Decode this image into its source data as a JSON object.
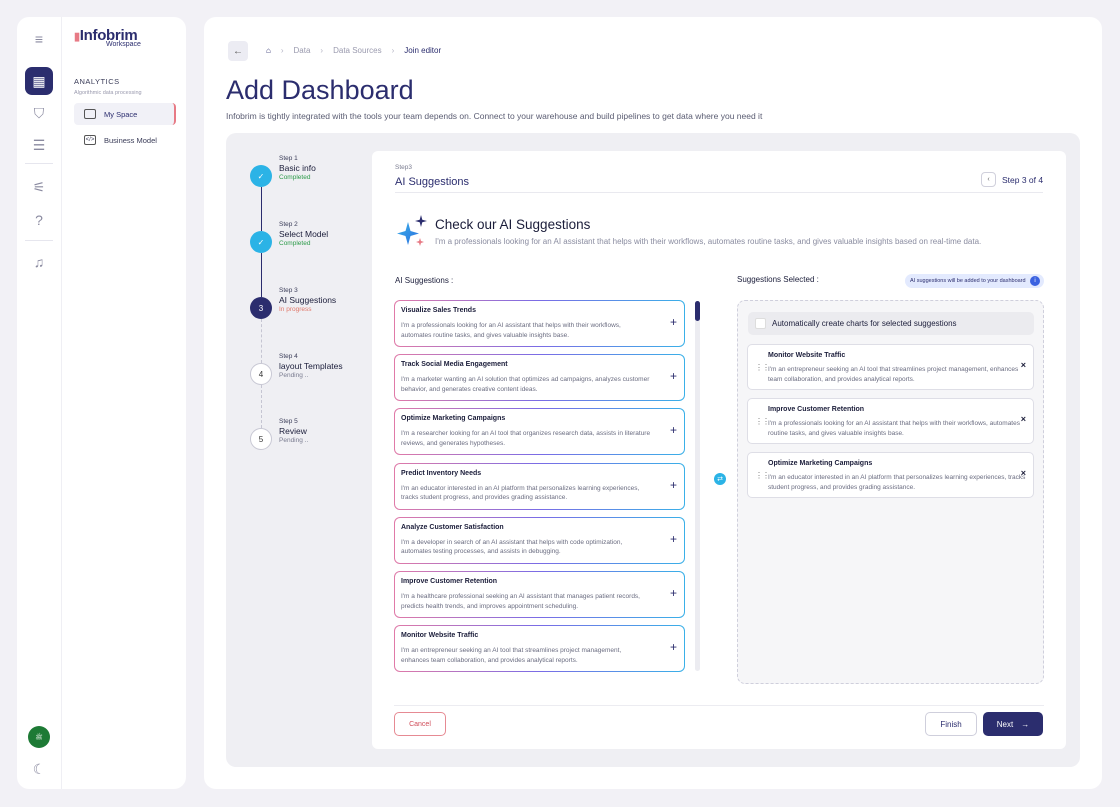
{
  "app": {
    "logo_text": "Infobrim",
    "logo_sub": "Workspace",
    "avatar_text": "ﷺ"
  },
  "rail": {
    "icons": [
      "menu-icon",
      "analytics-icon",
      "shield-icon",
      "database-icon",
      "sliders-icon",
      "help-icon",
      "bell-icon",
      "theme-toggle-icon"
    ],
    "active": "analytics-icon",
    "symbols": {
      "menu": "≡",
      "analytics": "▦",
      "shield": "⛉",
      "database": "☰",
      "sliders": "⚟",
      "help": "?",
      "bell": "♫",
      "moon": "☾"
    }
  },
  "sidebar": {
    "section_title": "ANALYTICS",
    "section_sub": "Algorithmic data processing",
    "items": [
      {
        "label": "My Space",
        "icon": "grid-icon",
        "active": true
      },
      {
        "label": "Business Model",
        "icon": "code-icon",
        "active": false
      }
    ]
  },
  "breadcrumb": {
    "items": [
      "Data",
      "Data Sources",
      "Join editor"
    ]
  },
  "header": {
    "title": "Add Dashboard",
    "description": "Infobrim is tightly integrated with the tools your team depends on. Connect to your warehouse and build pipelines to get data where you need it"
  },
  "stepper": [
    {
      "num": "Step 1",
      "name": "Basic info",
      "status": "Completed",
      "state": "done",
      "marker": "✓"
    },
    {
      "num": "Step 2",
      "name": "Select Model",
      "status": "Completed",
      "state": "done",
      "marker": "✓"
    },
    {
      "num": "Step 3",
      "name": "AI Suggestions",
      "status": "In progress",
      "state": "current",
      "marker": "3"
    },
    {
      "num": "Step 4",
      "name": "layout Templates",
      "status": "Pending ..",
      "state": "pending",
      "marker": "4"
    },
    {
      "num": "Step 5",
      "name": "Review",
      "status": "Pending ..",
      "state": "pending",
      "marker": "5"
    }
  ],
  "status_colors": {
    "done": "#2d9b4a",
    "current": "#e0786a",
    "pending": "#7a7c90"
  },
  "card": {
    "step_label": "Step3",
    "title": "AI Suggestions",
    "step_indicator": "Step 3 of 4",
    "ai_heading": "Check our AI Suggestions",
    "ai_desc": "I'm a professionals looking for an AI assistant that helps with their workflows, automates routine tasks, and gives valuable insights based on real-time data.",
    "left_header": "AI Suggestions :",
    "right_header": "Suggestions Selected :",
    "note": "AI suggestions will be added to your dashboard",
    "auto_create_label": "Automatically create charts for selected suggestions"
  },
  "suggestions": [
    {
      "title": "Visualize Sales Trends",
      "desc": "I'm a professionals looking for an AI assistant that helps with their workflows, automates routine tasks, and gives valuable insights base."
    },
    {
      "title": "Track Social Media Engagement",
      "desc": "I'm a marketer wanting an AI solution that optimizes ad campaigns, analyzes customer behavior, and generates creative content ideas."
    },
    {
      "title": "Optimize Marketing Campaigns",
      "desc": "I'm a researcher looking for an AI tool that organizes research data, assists in literature reviews, and generates hypotheses."
    },
    {
      "title": "Predict Inventory Needs",
      "desc": "I'm an educator interested in an AI platform that personalizes learning experiences, tracks student progress, and provides grading assistance."
    },
    {
      "title": "Analyze Customer Satisfaction",
      "desc": "I'm a developer in search of an AI assistant that helps with code optimization, automates testing processes, and assists in debugging."
    },
    {
      "title": "Improve Customer Retention",
      "desc": "I'm a healthcare professional seeking an AI assistant that manages patient records, predicts health trends, and improves appointment scheduling."
    },
    {
      "title": "Monitor Website Traffic",
      "desc": "I'm an entrepreneur seeking an AI tool that streamlines project management, enhances team collaboration, and provides analytical reports."
    }
  ],
  "selected": [
    {
      "title": "Monitor Website Traffic",
      "desc": "I'm an entrepreneur seeking an AI tool that streamlines project management, enhances team collaboration, and provides analytical reports."
    },
    {
      "title": "Improve Customer Retention",
      "desc": "I'm a professionals looking for an AI assistant that helps with their workflows, automates routine tasks, and gives valuable insights base."
    },
    {
      "title": "Optimize Marketing Campaigns",
      "desc": "I'm an educator interested in an AI platform that personalizes learning experiences, tracks student progress, and provides grading assistance."
    }
  ],
  "footer": {
    "cancel": "Cancel",
    "finish": "Finish",
    "next": "Next"
  }
}
